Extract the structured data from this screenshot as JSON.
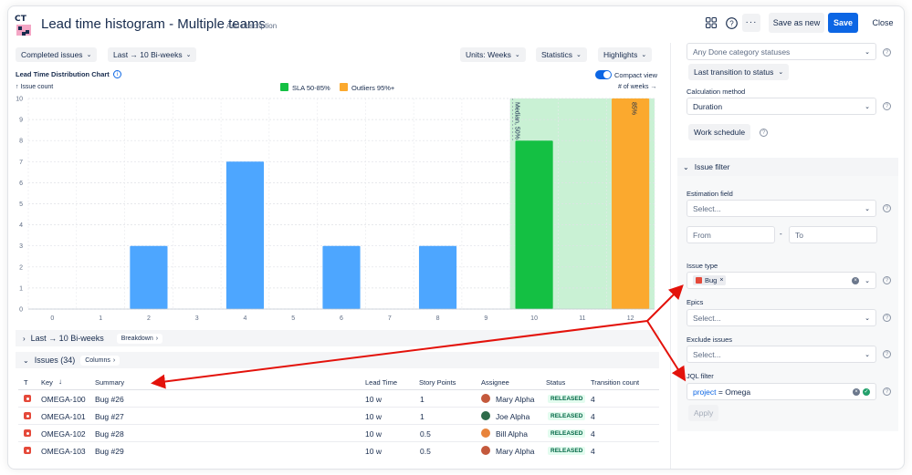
{
  "header": {
    "logo_text": "CT",
    "title": "Lead time histogram - Multiple teams",
    "add_description": "Add description",
    "save_as_new": "Save as new",
    "save": "Save",
    "close": "Close"
  },
  "toolbar": {
    "completed_issues": "Completed issues",
    "period": "Last → 10 Bi-weeks",
    "units": "Units: Weeks",
    "statistics": "Statistics",
    "highlights": "Highlights"
  },
  "chart_header": {
    "title": "Lead Time Distribution Chart",
    "compact_view": "Compact view",
    "y_axis_label": "↑ Issue count",
    "x_axis_label": "# of weeks →",
    "legend_sla": "SLA 50-85%",
    "legend_outliers": "Outliers 95%+",
    "median_label": "Median, 50%",
    "p85_label": "85%"
  },
  "chart_data": {
    "type": "bar",
    "categories": [
      "0",
      "1",
      "2",
      "3",
      "4",
      "5",
      "6",
      "7",
      "8",
      "9",
      "10",
      "11",
      "12"
    ],
    "values": [
      0,
      0,
      3,
      0,
      7,
      0,
      3,
      0,
      3,
      0,
      8,
      0,
      10
    ],
    "bar_colors": [
      "#4da6ff",
      "#4da6ff",
      "#4da6ff",
      "#4da6ff",
      "#4da6ff",
      "#4da6ff",
      "#4da6ff",
      "#4da6ff",
      "#4da6ff",
      "#4da6ff",
      "#14c043",
      "#4da6ff",
      "#fba92e"
    ],
    "title": "Lead Time Distribution Chart",
    "xlabel": "# of weeks",
    "ylabel": "Issue count",
    "ylim": [
      0,
      10
    ],
    "yticks": [
      0,
      1,
      2,
      3,
      4,
      5,
      6,
      7,
      8,
      9,
      10
    ],
    "sla_band": [
      10,
      12
    ],
    "sla_band_color": "#c9f1d4",
    "legend": [
      {
        "name": "SLA 50-85%",
        "color": "#14c043"
      },
      {
        "name": "Outliers 95%+",
        "color": "#fba92e"
      }
    ]
  },
  "breakdown": {
    "period": "Last → 10 Bi-weeks",
    "button": "Breakdown"
  },
  "issues": {
    "title": "Issues (34)",
    "columns_button": "Columns",
    "headers": {
      "t": "T",
      "key": "Key",
      "summary": "Summary",
      "lead_time": "Lead Time",
      "story_points": "Story Points",
      "assignee": "Assignee",
      "status": "Status",
      "transition_count": "Transition count"
    },
    "rows": [
      {
        "key": "OMEGA-100",
        "summary": "Bug #26",
        "lead_time": "10 w",
        "story_points": "1",
        "assignee": "Mary Alpha",
        "status": "RELEASED",
        "transition_count": "4"
      },
      {
        "key": "OMEGA-101",
        "summary": "Bug #27",
        "lead_time": "10 w",
        "story_points": "1",
        "assignee": "Joe Alpha",
        "status": "RELEASED",
        "transition_count": "4"
      },
      {
        "key": "OMEGA-102",
        "summary": "Bug #28",
        "lead_time": "10 w",
        "story_points": "0.5",
        "assignee": "Bill Alpha",
        "status": "RELEASED",
        "transition_count": "4"
      },
      {
        "key": "OMEGA-103",
        "summary": "Bug #29",
        "lead_time": "10 w",
        "story_points": "0.5",
        "assignee": "Mary Alpha",
        "status": "RELEASED",
        "transition_count": "4"
      }
    ]
  },
  "right_panel": {
    "done_statuses": "Any Done category statuses",
    "last_transition": "Last transition to status",
    "calc_method_label": "Calculation method",
    "calc_method_value": "Duration",
    "work_schedule": "Work schedule",
    "issue_filter": "Issue filter",
    "estimation_label": "Estimation field",
    "estimation_placeholder": "Select...",
    "from_placeholder": "From",
    "range_dash": "-",
    "to_placeholder": "To",
    "issue_type_label": "Issue type",
    "issue_type_chip": "Bug",
    "epics_label": "Epics",
    "epics_placeholder": "Select...",
    "exclude_label": "Exclude issues",
    "exclude_placeholder": "Select...",
    "jql_label": "JQL filter",
    "jql_keyword": "project",
    "jql_rest": " = Omega",
    "apply": "Apply"
  }
}
